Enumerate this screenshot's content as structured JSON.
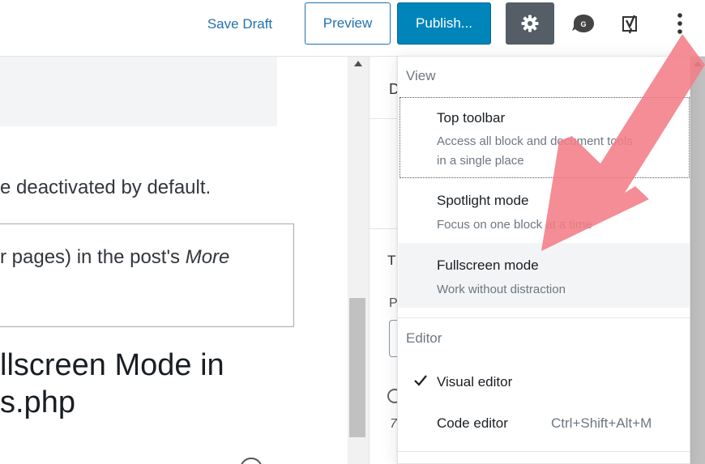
{
  "header": {
    "save_draft_label": "Save Draft",
    "preview_label": "Preview",
    "publish_label": "Publish..."
  },
  "editor": {
    "paragraph_1": "e deactivated by default.",
    "boxed_text_plain": "r pages) in the post's ",
    "boxed_text_italic": "More",
    "heading_line_1": "llscreen Mode in",
    "heading_line_2": "s.php"
  },
  "sidebar": {
    "tab_letter": "D",
    "section_letter": "T",
    "label_letter": "P",
    "footer_letter": "7"
  },
  "menu": {
    "view_label": "View",
    "editor_label": "Editor",
    "view_items": [
      {
        "title": "Top toolbar",
        "desc_line_1": "Access all block and document tools",
        "desc_line_2": "in a single place"
      },
      {
        "title": "Spotlight mode",
        "desc_line_1": "Focus on one block at a time"
      },
      {
        "title": "Fullscreen mode",
        "desc_line_1": "Work without distraction"
      }
    ],
    "editor_items": [
      {
        "title": "Visual editor",
        "checked": true
      },
      {
        "title": "Code editor",
        "shortcut": "Ctrl+Shift+Alt+M"
      }
    ]
  },
  "icons": {
    "settings": "gear-icon",
    "plugin": "gutenberg-plugin-icon",
    "yoast": "yoast-icon",
    "more": "more-vertical-icon",
    "check": "checkmark-icon"
  },
  "colors": {
    "accent": "#2271b1",
    "publish": "#0085ba",
    "annotation_arrow": "#f27d86"
  }
}
